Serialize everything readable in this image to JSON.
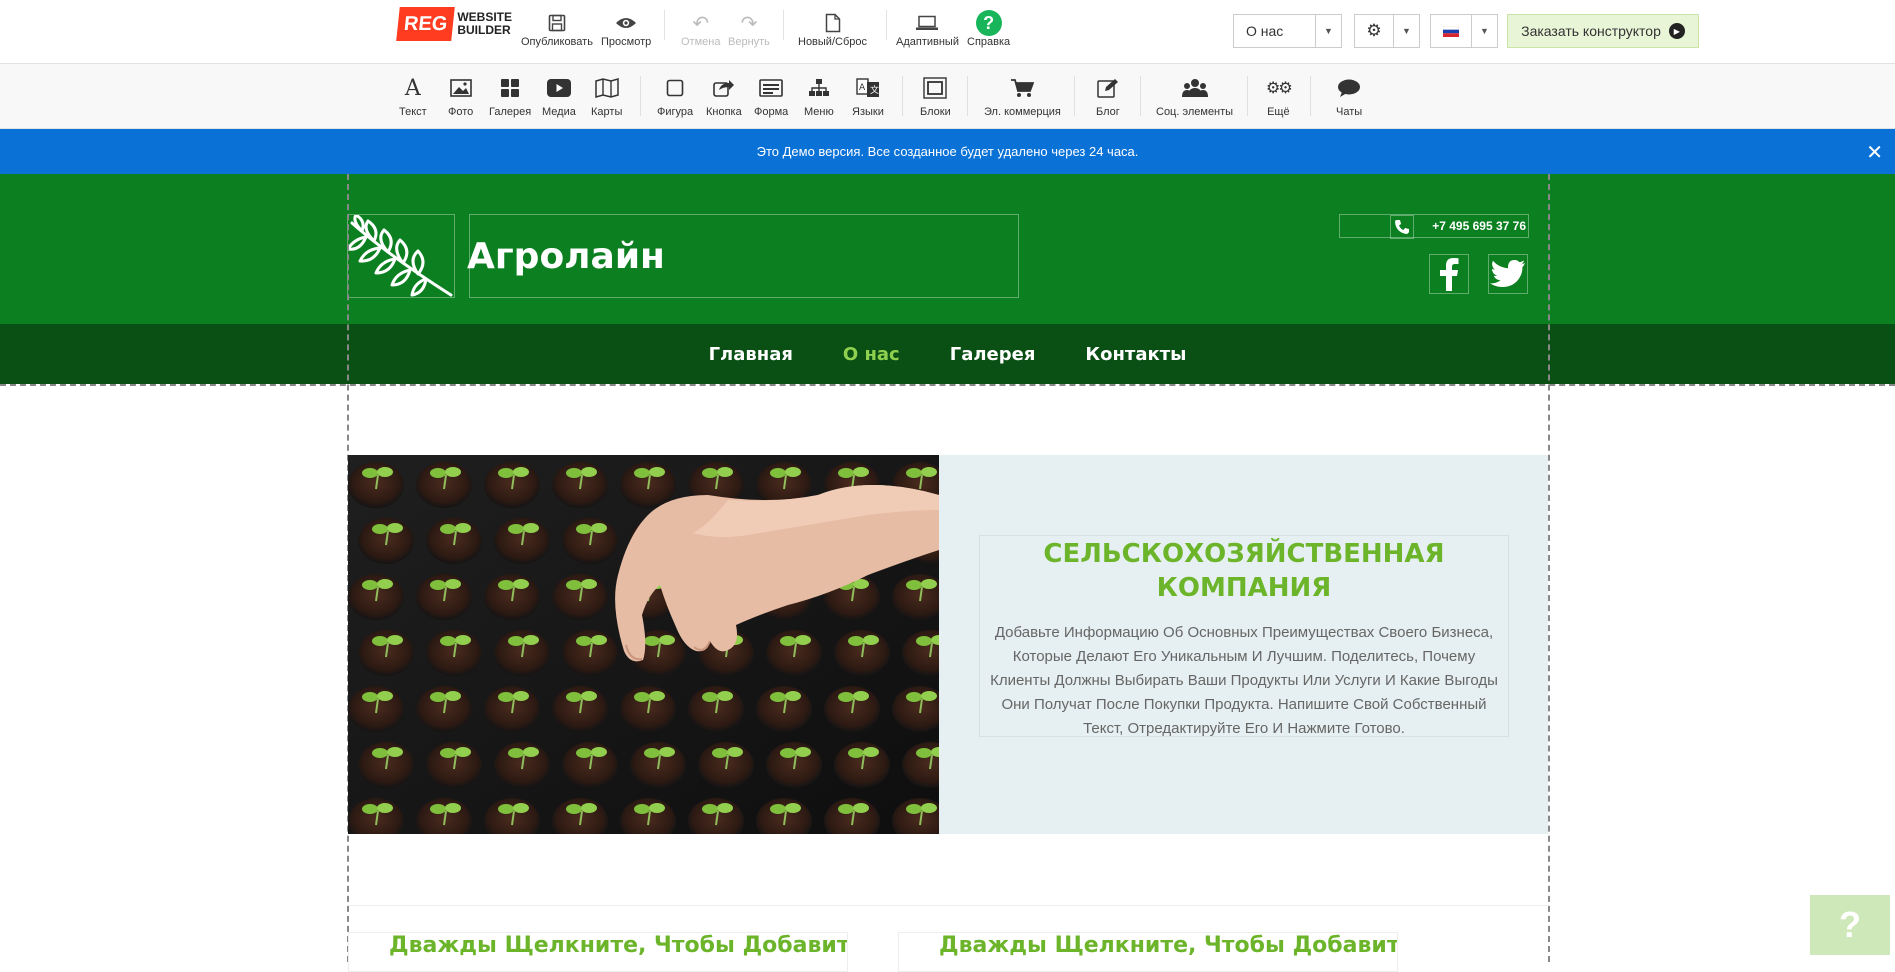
{
  "topbar": {
    "logo": {
      "mark": "REG",
      "line1": "WEBSITE",
      "line2": "BUILDER"
    },
    "publish_label": "Опубликовать",
    "preview_label": "Просмотр",
    "undo_label": "Отмена",
    "redo_label": "Вернуть",
    "new_reset_label": "Новый/Сброс",
    "adaptive_label": "Адаптивный",
    "help_label": "Справка",
    "page_select_value": "О нас",
    "order_label": "Заказать конструктор"
  },
  "toolbar": {
    "items": [
      {
        "label": "Текст",
        "icon": "text-icon"
      },
      {
        "label": "Фото",
        "icon": "photo-icon"
      },
      {
        "label": "Галерея",
        "icon": "gallery-icon"
      },
      {
        "label": "Медиа",
        "icon": "media-icon"
      },
      {
        "label": "Карты",
        "icon": "map-icon"
      },
      {
        "label": "Фигура",
        "icon": "shape-icon"
      },
      {
        "label": "Кнопка",
        "icon": "button-icon"
      },
      {
        "label": "Форма",
        "icon": "form-icon"
      },
      {
        "label": "Меню",
        "icon": "menu-icon"
      },
      {
        "label": "Языки",
        "icon": "languages-icon"
      },
      {
        "label": "Блоки",
        "icon": "blocks-icon"
      },
      {
        "label": "Эл. коммерция",
        "icon": "cart-icon"
      },
      {
        "label": "Блог",
        "icon": "blog-icon"
      },
      {
        "label": "Соц. элементы",
        "icon": "social-icon"
      },
      {
        "label": "Ещё",
        "icon": "more-icon"
      },
      {
        "label": "Чаты",
        "icon": "chat-icon"
      }
    ]
  },
  "banner": {
    "text": "Это Демо версия. Все созданное будет удалено через 24 часа.",
    "close_glyph": "✕"
  },
  "site": {
    "title": "Агролайн",
    "phone": "+7 495 695 37 76",
    "nav": [
      {
        "label": "Главная",
        "active": false
      },
      {
        "label": "О нас",
        "active": true
      },
      {
        "label": "Галерея",
        "active": false
      },
      {
        "label": "Контакты",
        "active": false
      }
    ],
    "hero": {
      "heading": "СЕЛЬСКОХОЗЯЙСТВЕННАЯ КОМПАНИЯ",
      "text": "Добавьте Информацию Об Основных Преимуществах Своего Бизнеса, Которые Делают Его Уникальным И Лучшим. Поделитесь, Почему Клиенты Должны Выбирать Ваши Продукты Или Услуги И Какие Выгоды Они Получат После Покупки Продукта. Напишите Свой Собственный Текст, Отредактируйте Его И Нажмите Готово."
    },
    "teasers": [
      "Дважды Щелкните, Чтобы Добавить Свой",
      "Дважды Щелкните, Чтобы Добавить Свой"
    ]
  },
  "colors": {
    "header_green": "#0c8020",
    "nav_dark_green": "#0a4f14",
    "accent_green": "#6cb52b",
    "banner_blue": "#0a71d6"
  }
}
